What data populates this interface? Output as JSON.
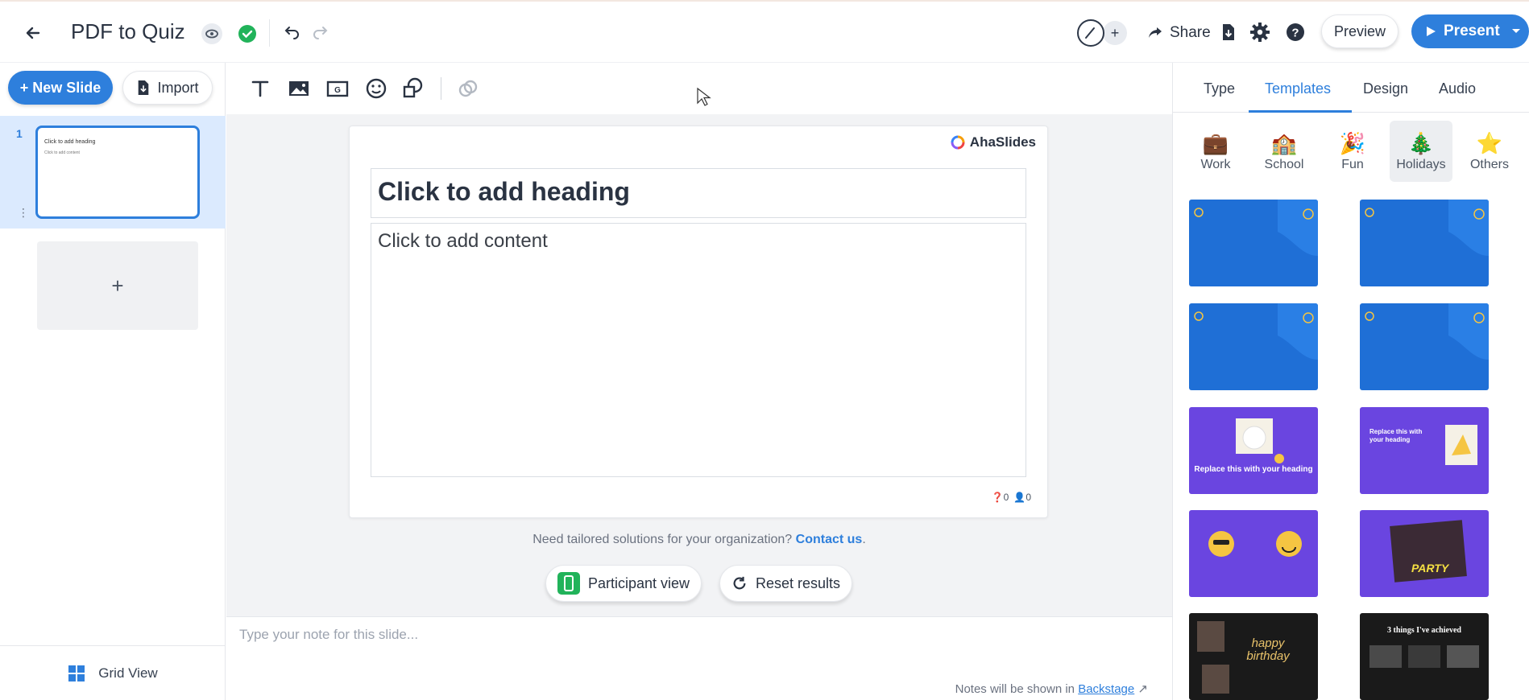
{
  "header": {
    "title": "PDF to Quiz",
    "share_label": "Share",
    "preview_label": "Preview",
    "present_label": "Present"
  },
  "left": {
    "new_slide_label": "+ New Slide",
    "import_label": "Import",
    "slide_number": "1",
    "thumb_heading": "Click to add heading",
    "thumb_content": "Click to add content",
    "add_label": "+",
    "grid_view_label": "Grid View"
  },
  "canvas": {
    "brand": "AhaSlides",
    "heading": "Click to add heading",
    "content": "Click to add content",
    "question_count": "0",
    "people_count": "0"
  },
  "center": {
    "promo_text": "Need tailored solutions for your organization?",
    "promo_link": "Contact us",
    "promo_end": ".",
    "participant_view_label": "Participant view",
    "reset_results_label": "Reset results"
  },
  "notes": {
    "placeholder": "Type your note for this slide...",
    "footer_text": "Notes will be shown in",
    "footer_link": "Backstage"
  },
  "right": {
    "tabs": [
      "Type",
      "Templates",
      "Design",
      "Audio"
    ],
    "active_tab": "Templates",
    "categories": [
      {
        "label": "Work",
        "icon": "briefcase-icon"
      },
      {
        "label": "School",
        "icon": "school-icon"
      },
      {
        "label": "Fun",
        "icon": "party-popper-icon"
      },
      {
        "label": "Holidays",
        "icon": "christmas-tree-icon"
      },
      {
        "label": "Others",
        "icon": "star-icon"
      }
    ],
    "active_category": "Holidays",
    "template_texts": {
      "purple_heading": "Replace this with your heading",
      "party": "PARTY",
      "happy_birthday": "happy birthday",
      "achieved": "3 things I've achieved"
    }
  },
  "colors": {
    "accent": "#2e7fdc",
    "success": "#21b35a",
    "selected_row": "#dbeafe"
  }
}
